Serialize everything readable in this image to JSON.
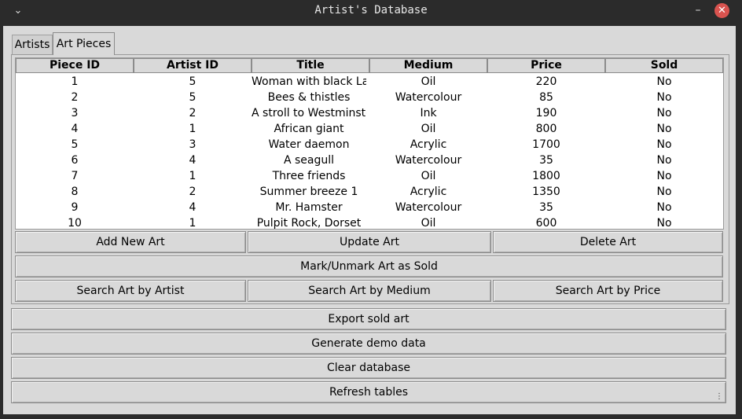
{
  "window": {
    "title": "Artist's Database",
    "menu_icon": "chevron-down-icon",
    "minimize_icon": "minimize-icon",
    "close_icon": "close-icon"
  },
  "tabs": [
    {
      "label": "Artists",
      "active": false
    },
    {
      "label": "Art Pieces",
      "active": true
    }
  ],
  "table": {
    "columns": [
      "Piece ID",
      "Artist ID",
      "Title",
      "Medium",
      "Price",
      "Sold"
    ],
    "rows": [
      [
        "1",
        "5",
        "Woman with black Lal",
        "Oil",
        "220",
        "No"
      ],
      [
        "2",
        "5",
        "Bees & thistles",
        "Watercolour",
        "85",
        "No"
      ],
      [
        "3",
        "2",
        "A stroll to Westminste",
        "Ink",
        "190",
        "No"
      ],
      [
        "4",
        "1",
        "African giant",
        "Oil",
        "800",
        "No"
      ],
      [
        "5",
        "3",
        "Water daemon",
        "Acrylic",
        "1700",
        "No"
      ],
      [
        "6",
        "4",
        "A seagull",
        "Watercolour",
        "35",
        "No"
      ],
      [
        "7",
        "1",
        "Three friends",
        "Oil",
        "1800",
        "No"
      ],
      [
        "8",
        "2",
        "Summer breeze 1",
        "Acrylic",
        "1350",
        "No"
      ],
      [
        "9",
        "4",
        "Mr. Hamster",
        "Watercolour",
        "35",
        "No"
      ],
      [
        "10",
        "1",
        "Pulpit Rock, Dorset",
        "Oil",
        "600",
        "No"
      ]
    ]
  },
  "art_buttons": {
    "add": "Add New Art",
    "update": "Update Art",
    "delete": "Delete Art",
    "mark_sold": "Mark/Unmark Art as Sold",
    "search_artist": "Search Art by Artist",
    "search_medium": "Search Art by Medium",
    "search_price": "Search Art by Price"
  },
  "global_buttons": {
    "export": "Export sold art",
    "demo": "Generate demo data",
    "clear": "Clear database",
    "refresh": "Refresh tables"
  }
}
